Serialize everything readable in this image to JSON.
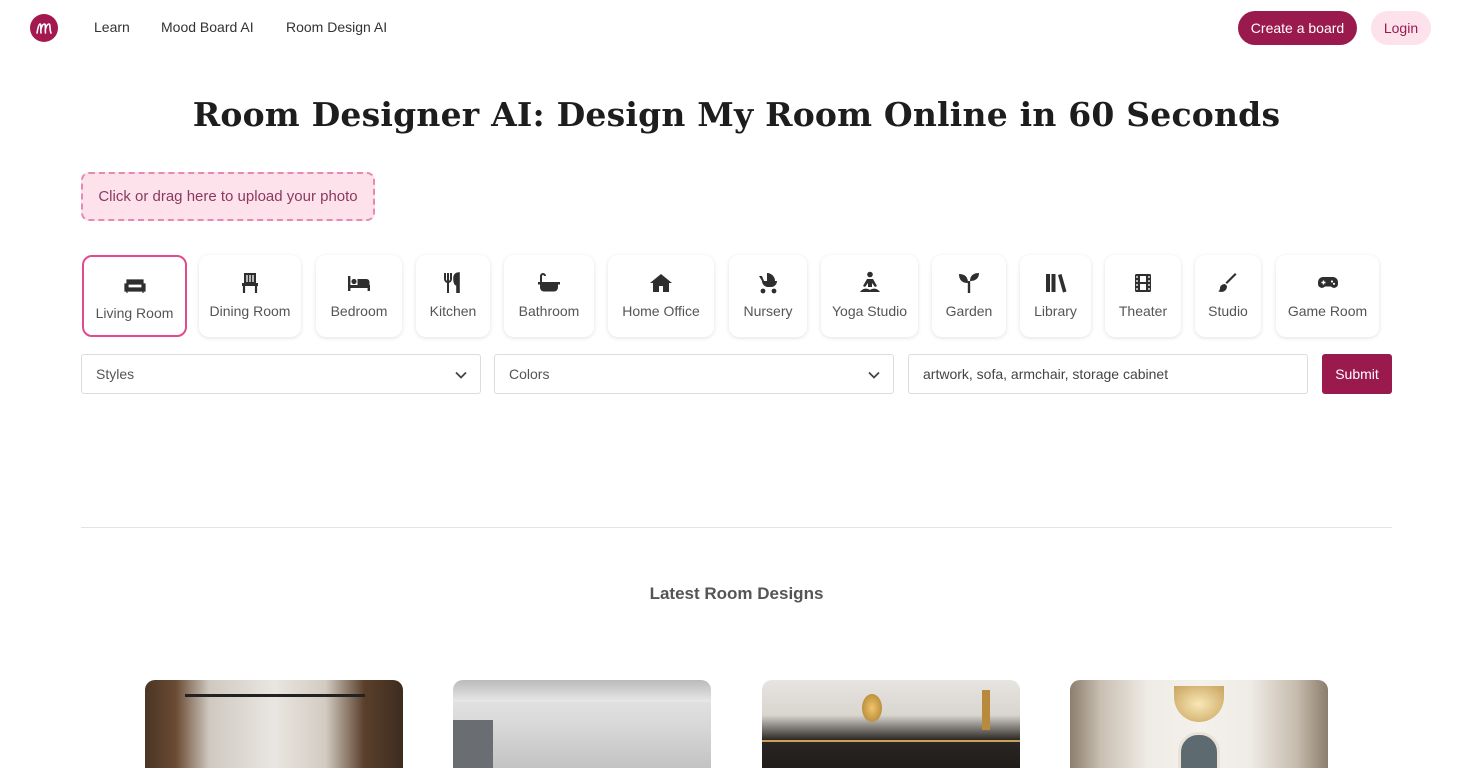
{
  "header": {
    "logo_letter": "m",
    "nav": [
      "Learn",
      "Mood Board AI",
      "Room Design AI"
    ],
    "create_label": "Create a board",
    "login_label": "Login",
    "brand_color": "#9b1a4e"
  },
  "title": "Room Designer AI: Design My Room Online in 60 Seconds",
  "upload_label": "Click or drag here to upload your photo",
  "rooms": [
    {
      "label": "Living Room",
      "icon": "sofa-icon",
      "selected": true
    },
    {
      "label": "Dining Room",
      "icon": "chair-icon",
      "selected": false
    },
    {
      "label": "Bedroom",
      "icon": "bed-icon",
      "selected": false
    },
    {
      "label": "Kitchen",
      "icon": "utensils-icon",
      "selected": false
    },
    {
      "label": "Bathroom",
      "icon": "bathtub-icon",
      "selected": false
    },
    {
      "label": "Home Office",
      "icon": "house-icon",
      "selected": false
    },
    {
      "label": "Nursery",
      "icon": "stroller-icon",
      "selected": false
    },
    {
      "label": "Yoga Studio",
      "icon": "meditation-icon",
      "selected": false
    },
    {
      "label": "Garden",
      "icon": "seedling-icon",
      "selected": false
    },
    {
      "label": "Library",
      "icon": "books-icon",
      "selected": false
    },
    {
      "label": "Theater",
      "icon": "film-icon",
      "selected": false
    },
    {
      "label": "Studio",
      "icon": "paintbrush-icon",
      "selected": false
    },
    {
      "label": "Game Room",
      "icon": "gamepad-icon",
      "selected": false
    }
  ],
  "form": {
    "styles_label": "Styles",
    "colors_label": "Colors",
    "items_value": "artwork, sofa, armchair, storage cabinet",
    "submit_label": "Submit"
  },
  "latest_title": "Latest Room Designs"
}
